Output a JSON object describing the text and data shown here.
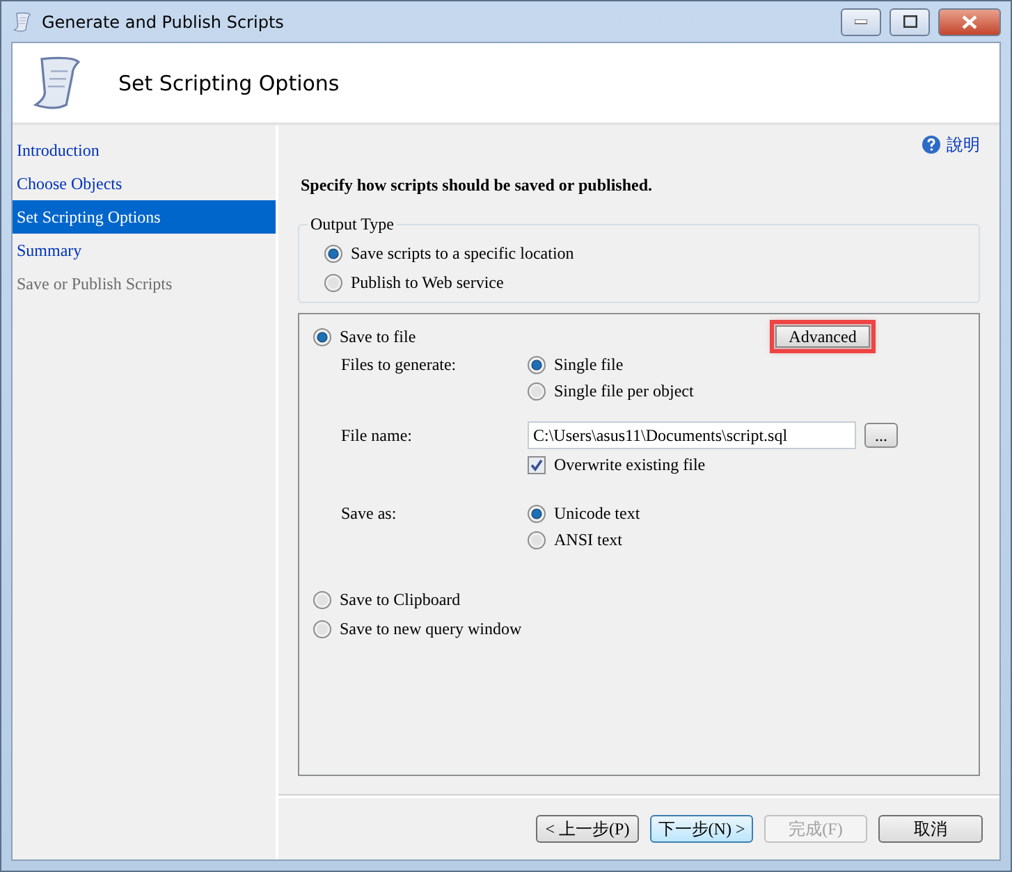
{
  "window": {
    "title": "Generate and Publish Scripts"
  },
  "header": {
    "title": "Set Scripting Options"
  },
  "sidebar": {
    "items": [
      {
        "label": "Introduction",
        "selected": false,
        "disabled": false
      },
      {
        "label": "Choose Objects",
        "selected": false,
        "disabled": false
      },
      {
        "label": "Set Scripting Options",
        "selected": true,
        "disabled": false
      },
      {
        "label": "Summary",
        "selected": false,
        "disabled": false
      },
      {
        "label": "Save or Publish Scripts",
        "selected": false,
        "disabled": true
      }
    ]
  },
  "help": {
    "label": "說明"
  },
  "instruction": "Specify how scripts should be saved or published.",
  "output_type": {
    "legend": "Output Type",
    "options": [
      {
        "label": "Save scripts to a specific location",
        "selected": true
      },
      {
        "label": "Publish to Web service",
        "selected": false
      }
    ]
  },
  "save_to_file": {
    "label": "Save to file",
    "selected": true
  },
  "advanced_button": {
    "label": "Advanced",
    "highlighted": true
  },
  "files_to_generate": {
    "label": "Files to generate:",
    "options": [
      {
        "label": "Single file",
        "selected": true
      },
      {
        "label": "Single file per object",
        "selected": false
      }
    ]
  },
  "file_name": {
    "label": "File name:",
    "value": "C:\\Users\\asus11\\Documents\\script.sql",
    "browse_button": "..."
  },
  "overwrite": {
    "label": "Overwrite existing file",
    "checked": true
  },
  "save_as": {
    "label": "Save as:",
    "options": [
      {
        "label": "Unicode text",
        "selected": true
      },
      {
        "label": "ANSI text",
        "selected": false
      }
    ]
  },
  "other_destinations": [
    {
      "label": "Save to Clipboard",
      "selected": false
    },
    {
      "label": "Save to new query window",
      "selected": false
    }
  ],
  "buttons": [
    {
      "label": "< 上一步(P)",
      "default": false,
      "disabled": false
    },
    {
      "label": "下一步(N) >",
      "default": true,
      "disabled": false
    },
    {
      "label": "完成(F)",
      "default": false,
      "disabled": true
    },
    {
      "label": "取消",
      "default": false,
      "disabled": false
    }
  ]
}
